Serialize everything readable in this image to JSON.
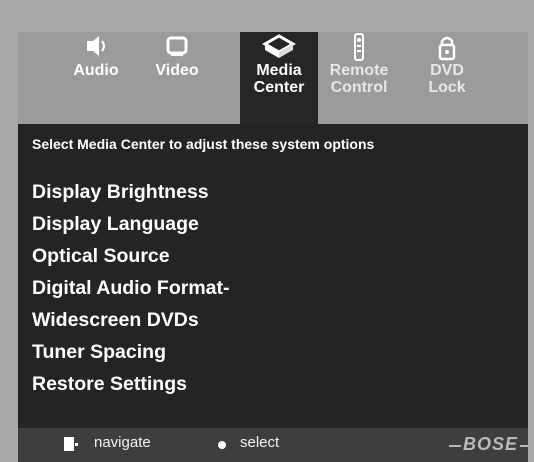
{
  "tabs": [
    {
      "label": "Audio",
      "icon": "speaker-icon",
      "active": false
    },
    {
      "label": "Video",
      "icon": "tv-icon",
      "active": false
    },
    {
      "label": "Media\nCenter",
      "icon": "media-center-icon",
      "active": true
    },
    {
      "label": "Remote\nControl",
      "icon": "remote-control-icon",
      "active": false
    },
    {
      "label": "DVD\nLock",
      "icon": "lock-icon",
      "active": false
    }
  ],
  "panel": {
    "instruction": "Select Media Center to adjust these system options",
    "menu_items": [
      "Display Brightness",
      "Display Language",
      "Optical Source",
      "Digital Audio Format-",
      "Widescreen DVDs",
      "Tuner Spacing",
      "Restore Settings"
    ]
  },
  "footer": {
    "navigate_label": "navigate",
    "select_label": "select",
    "brand": "BOSE"
  },
  "colors": {
    "background": "#a8a8a8",
    "panel": "#242424",
    "active_tab": "#262626",
    "footer": "#3e3e3e",
    "text": "#ffffff"
  }
}
